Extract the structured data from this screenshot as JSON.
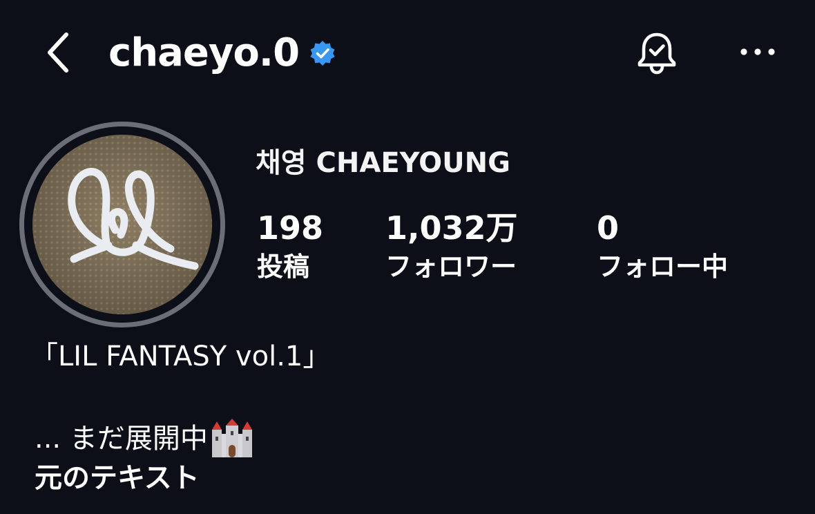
{
  "header": {
    "username": "chaeyo.0",
    "back_icon": "chevron-left-icon",
    "verified_icon": "verified-badge-icon",
    "notification_icon": "bell-check-icon",
    "more_icon": "more-horizontal-icon",
    "verified_color": "#3897f0"
  },
  "profile": {
    "display_name": "채영 CHAEYOUNG",
    "stats": {
      "posts": {
        "value": "198",
        "label": "投稿"
      },
      "followers": {
        "value": "1,032万",
        "label": "フォロワー"
      },
      "following": {
        "value": "0",
        "label": "フォロー中"
      }
    }
  },
  "bio": {
    "title": "「LIL FANTASY vol.1」",
    "more_text": "... まだ展開中",
    "more_emoji": "castle-icon",
    "translate_link": "元のテキスト"
  },
  "colors": {
    "background": "#0c0f18",
    "text": "#ffffff",
    "avatar_ring": "#6b6e76"
  }
}
